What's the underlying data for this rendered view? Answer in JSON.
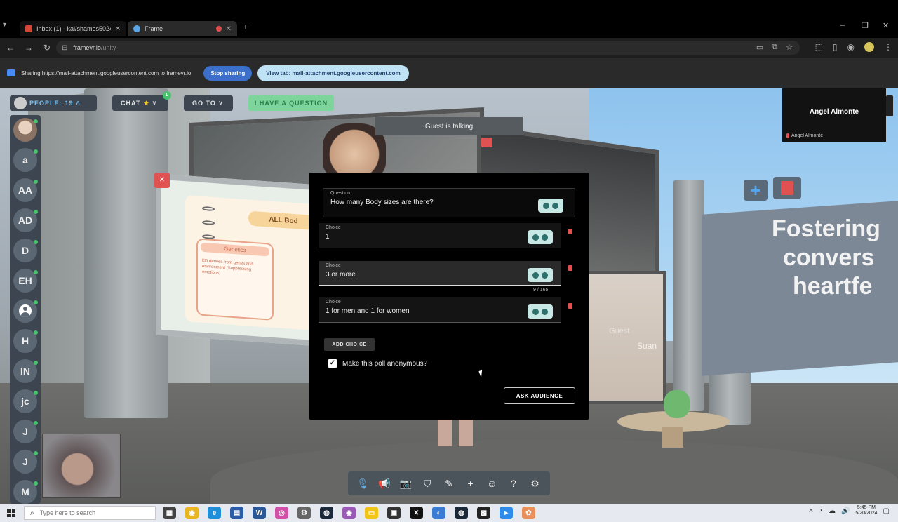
{
  "browser": {
    "tabs": [
      {
        "title": "Inbox (1) - kai/shames5024@g",
        "favicon_color": "#d44638"
      },
      {
        "title": "Frame",
        "favicon_color": "#58a6e6"
      }
    ],
    "new_tab": "+",
    "url_host": "framevr.io",
    "url_path": "/unity",
    "window_controls": {
      "minimize": "–",
      "maximize": "❐",
      "close": "✕"
    }
  },
  "sharing_bar": {
    "text": "Sharing https://mail-attachment.googleusercontent.com to framevr.io",
    "stop_label": "Stop sharing",
    "view_tab_label": "View tab: mail-attachment.googleusercontent.com"
  },
  "frame_ui": {
    "people_label": "PEOPLE:",
    "people_count": "19",
    "chat_label": "CHAT",
    "chat_badge": "1",
    "goto_label": "GO TO",
    "question_label": "I HAVE A QUESTION",
    "talking_text": "Guest is talking",
    "people_rail": [
      "a",
      "AA",
      "AD",
      "D",
      "EH",
      "",
      "H",
      "IN",
      "jc",
      "J",
      "J",
      "M"
    ]
  },
  "video_tile": {
    "name": "Angel Almonte",
    "footer_name": "Angel Almonte"
  },
  "scene": {
    "slide_title": "ALL Bod",
    "slide_box_heading": "Genetics",
    "slide_box_text": "ED derives from genes and environment (Suppressing emotions)",
    "fostering_lines": [
      "Fostering",
      "convers",
      "heartfe"
    ],
    "guest_label": "Guest",
    "suan_label": "Suan"
  },
  "poll": {
    "question_label": "Question",
    "question_value": "How many Body sizes are there?",
    "choices": [
      {
        "label": "Choice",
        "value": "1"
      },
      {
        "label": "Choice",
        "value": "3 or more"
      },
      {
        "label": "Choice",
        "value": "1 for men and 1 for women"
      }
    ],
    "char_counter": "9 / 165",
    "add_choice_label": "ADD CHOICE",
    "anonymous_label": "Make this poll anonymous?",
    "anonymous_checked": true,
    "ask_label": "ASK AUDIENCE"
  },
  "bottom_toolbar": [
    "mic-icon",
    "megaphone-icon",
    "camera-icon",
    "seat-icon",
    "pen-icon",
    "plus-icon",
    "emoji-icon",
    "help-icon",
    "settings-icon"
  ],
  "taskbar": {
    "search_placeholder": "Type here to search",
    "time": "5:45 PM",
    "date": "5/20/2024"
  },
  "colors": {
    "accent_blue": "#3b6fc9",
    "question_green": "#7dd59c",
    "danger_red": "#e05252"
  }
}
